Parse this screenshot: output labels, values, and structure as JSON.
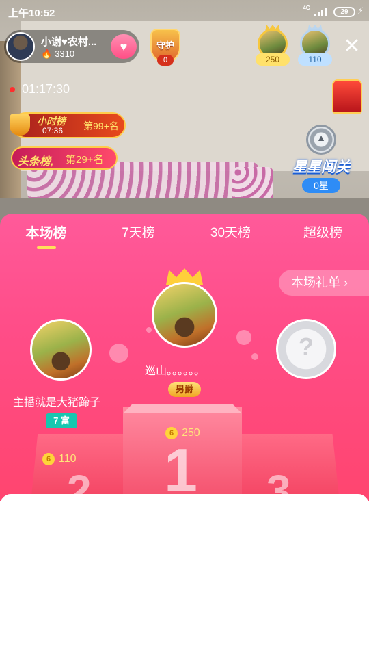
{
  "status_bar": {
    "time": "上午10:52",
    "network": "4G",
    "battery": "29"
  },
  "anchor": {
    "name": "小谢♥农村...",
    "heat": "3310",
    "follow_icon": "heart-icon"
  },
  "guard": {
    "label": "守护",
    "count": "0"
  },
  "top_viewers": [
    {
      "value": "250"
    },
    {
      "value": "110"
    }
  ],
  "live_timer": "01:17:30",
  "hour_rank": {
    "title": "小时榜",
    "time": "07:36",
    "rank": "第99+名"
  },
  "headline_rank": {
    "title": "头条榜,",
    "rank": "第29+名"
  },
  "star_level": {
    "title": "星星闯关",
    "count": "0星"
  },
  "rank_panel": {
    "tabs": [
      "本场榜",
      "7天榜",
      "30天榜",
      "超级榜"
    ],
    "active_tab": 0,
    "gift_list_label": "本场礼单 ›",
    "first": {
      "name": "巡山。。。。。。",
      "badge": "男爵",
      "score": "250",
      "podium_number": "1"
    },
    "second": {
      "name": "主播就是大猪蹄子",
      "badge": "7 富",
      "score": "110",
      "podium_number": "2"
    },
    "third": {
      "podium_number": "3",
      "placeholder": "?"
    }
  },
  "colors": {
    "panel_pink": "#ff4d88",
    "tab_underline": "#ffdf5a",
    "score_gold": "#ffe57a",
    "wealth_teal": "#17c7b0"
  }
}
